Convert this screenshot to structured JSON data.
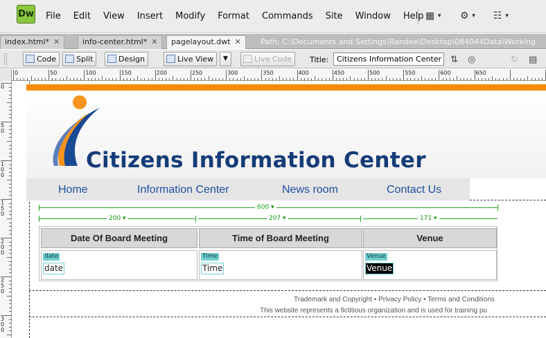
{
  "app": {
    "logo": "Dw",
    "menu": [
      "File",
      "Edit",
      "View",
      "Insert",
      "Modify",
      "Format",
      "Commands",
      "Site",
      "Window",
      "Help"
    ]
  },
  "tabs": [
    {
      "label": "index.html*"
    },
    {
      "label": "info-center.html*"
    },
    {
      "label": "pagelayout.dwt"
    }
  ],
  "path": "Path:  C:\\Documents and Settings\\Randee\\Desktop\\084044Data\\Working",
  "toolbar": {
    "code": "Code",
    "split": "Split",
    "design": "Design",
    "live_view": "Live View",
    "live_code": "Live Code",
    "title_label": "Title:",
    "title_value": "Citizens Information Center |"
  },
  "ruler": {
    "h_labels": [
      "0",
      "50",
      "100",
      "150",
      "200",
      "250",
      "300",
      "350",
      "400",
      "450",
      "500",
      "550",
      "600",
      "650"
    ],
    "v_labels": [
      "0",
      "50",
      "100",
      "150",
      "200",
      "250",
      "300"
    ]
  },
  "page": {
    "site_title": "Citizens Information Center",
    "nav": [
      "Home",
      "Information Center",
      "News room",
      "Contact Us"
    ],
    "col_widths": {
      "total": "600 ▾",
      "c1": "200 ▾",
      "c2": "207 ▾",
      "c3": "171 ▾"
    },
    "table": {
      "headers": [
        "Date Of Board Meeting",
        "Time of Board Meeting",
        "Venue"
      ],
      "cells": [
        {
          "tag": "date",
          "value": "date"
        },
        {
          "tag": "Time",
          "value": "Time"
        },
        {
          "tag": "Venue",
          "value": "Venue"
        }
      ]
    },
    "footer": {
      "line1": "Trademark and Copyright • Privacy Policy • Terms and Conditions",
      "line2": "This website represents a fictitious organization and is used for training pu"
    }
  },
  "colors": {
    "accent_orange": "#f58a07",
    "title_blue": "#153c78",
    "nav_blue": "#1f4fa0",
    "dw_green": "#8cc63e",
    "tag_teal": "#73cdd0",
    "width_green": "#27a127"
  }
}
